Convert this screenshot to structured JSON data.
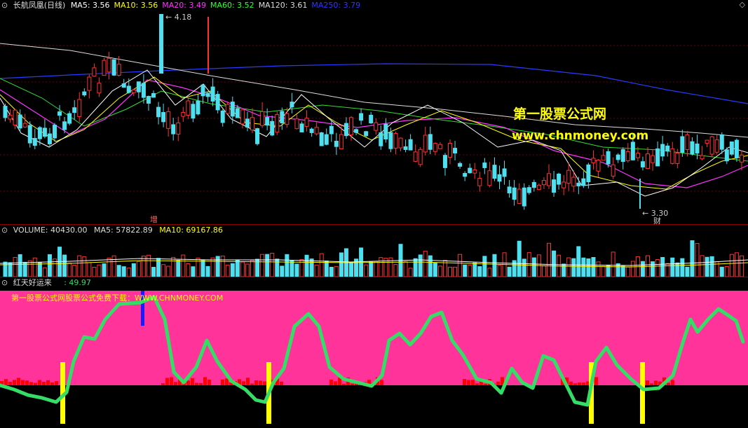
{
  "main_chart": {
    "title": "长航凤凰(日线)",
    "ma": [
      {
        "label": "MA5: 3.56",
        "color": "#ffffff"
      },
      {
        "label": "MA10: 3.56",
        "color": "#ffff00"
      },
      {
        "label": "MA20: 3.49",
        "color": "#ff33ff"
      },
      {
        "label": "MA60: 3.52",
        "color": "#33ff33"
      },
      {
        "label": "MA120: 3.61",
        "color": "#dddddd"
      },
      {
        "label": "MA250: 3.79",
        "color": "#3333ff"
      }
    ],
    "high_label": "4.18",
    "low_label": "3.30",
    "tag_zeng": "增",
    "tag_cai": "财",
    "watermark_cn": "第一股票公式网",
    "watermark_url": "www.chnmoney.com"
  },
  "volume_panel": {
    "label": "VOLUME: 40430.00",
    "ma5": "MA5: 57822.89",
    "ma10": "MA10: 69167.86"
  },
  "indicator_panel": {
    "name": "红天好运来",
    "value": ": 49.97",
    "banner": "第一股票公式网股票公式免费下载：WWW.CHNMONEY.COM",
    "colors": {
      "fill": "#ff3399",
      "line": "#33dd66",
      "marker": "#ffff00"
    }
  },
  "chart_data": [
    {
      "type": "line",
      "title": "长航凤凰(日线)",
      "series": [
        {
          "name": "MA5",
          "values": [
            3.56
          ]
        },
        {
          "name": "MA10",
          "values": [
            3.56
          ]
        },
        {
          "name": "MA20",
          "values": [
            3.49
          ]
        },
        {
          "name": "MA60",
          "values": [
            3.52
          ]
        },
        {
          "name": "MA120",
          "values": [
            3.61
          ]
        },
        {
          "name": "MA250",
          "values": [
            3.79
          ]
        }
      ],
      "annotations": [
        "4.18",
        "3.30"
      ]
    },
    {
      "type": "bar",
      "title": "VOLUME",
      "series": [
        {
          "name": "VOLUME",
          "values": [
            40430.0
          ]
        },
        {
          "name": "MA5",
          "values": [
            57822.89
          ]
        },
        {
          "name": "MA10",
          "values": [
            69167.86
          ]
        }
      ]
    },
    {
      "type": "line",
      "title": "红天好运来",
      "series": [
        {
          "name": "红天好运来",
          "values": [
            49.97
          ]
        }
      ]
    }
  ]
}
